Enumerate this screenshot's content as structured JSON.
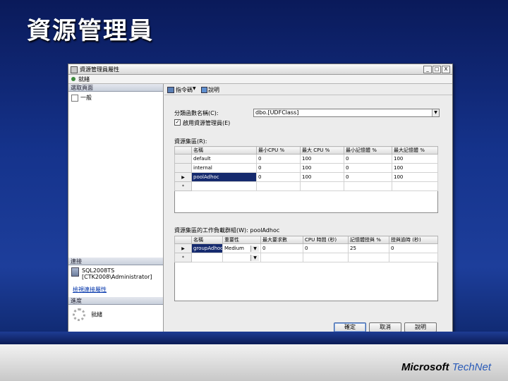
{
  "slide": {
    "title": "資源管理員",
    "brand_left": "Microsoft",
    "brand_right": "TechNet"
  },
  "window": {
    "title": "資源管理員屬性",
    "status": "就緒",
    "controls": [
      "_",
      "□",
      "X"
    ],
    "left": {
      "select_page": "選取頁面",
      "page_item": "一般",
      "connection": "連接",
      "server": "SQL2008TS",
      "login": "[CTK2008\\Administrator]",
      "view_conn": "檢視連接屬性",
      "progress": "進度",
      "progress_status": "就緒"
    },
    "toolbar": {
      "script": "指令碼",
      "caret": "▼",
      "help": "說明"
    },
    "classifier_label": "分類函數名稱(C):",
    "classifier_value": "dbo.[UDFClass]",
    "enable_label": "啟用資源管理員(E)",
    "enable_checked": "✓",
    "pools_label": "資源集區(R):",
    "pools": {
      "headers": [
        "",
        "名稱",
        "最小CPU %",
        "最大 CPU %",
        "最小記憶體 %",
        "最大記憶體 %"
      ],
      "rows": [
        [
          "",
          "default",
          "0",
          "100",
          "0",
          "100"
        ],
        [
          "",
          "internal",
          "0",
          "100",
          "0",
          "100"
        ],
        [
          "▶",
          "poolAdhoc",
          "0",
          "100",
          "0",
          "100"
        ],
        [
          "*",
          "",
          "",
          "",
          "",
          ""
        ]
      ]
    },
    "groups_label": "資源集區的工作負載群組(W): poolAdhoc",
    "groups": {
      "headers": [
        "",
        "名稱",
        "重要性",
        "最大要求數",
        "CPU 時間 (秒)",
        "記憶體授與 %",
        "授與逾時 (秒)"
      ],
      "rows": [
        [
          "▶",
          "groupAdhoc",
          "Medium",
          "0",
          "0",
          "25",
          "0"
        ],
        [
          "*",
          "",
          "",
          "",
          "",
          "",
          ""
        ]
      ]
    },
    "buttons": {
      "ok": "確定",
      "cancel": "取消",
      "help": "說明"
    }
  }
}
